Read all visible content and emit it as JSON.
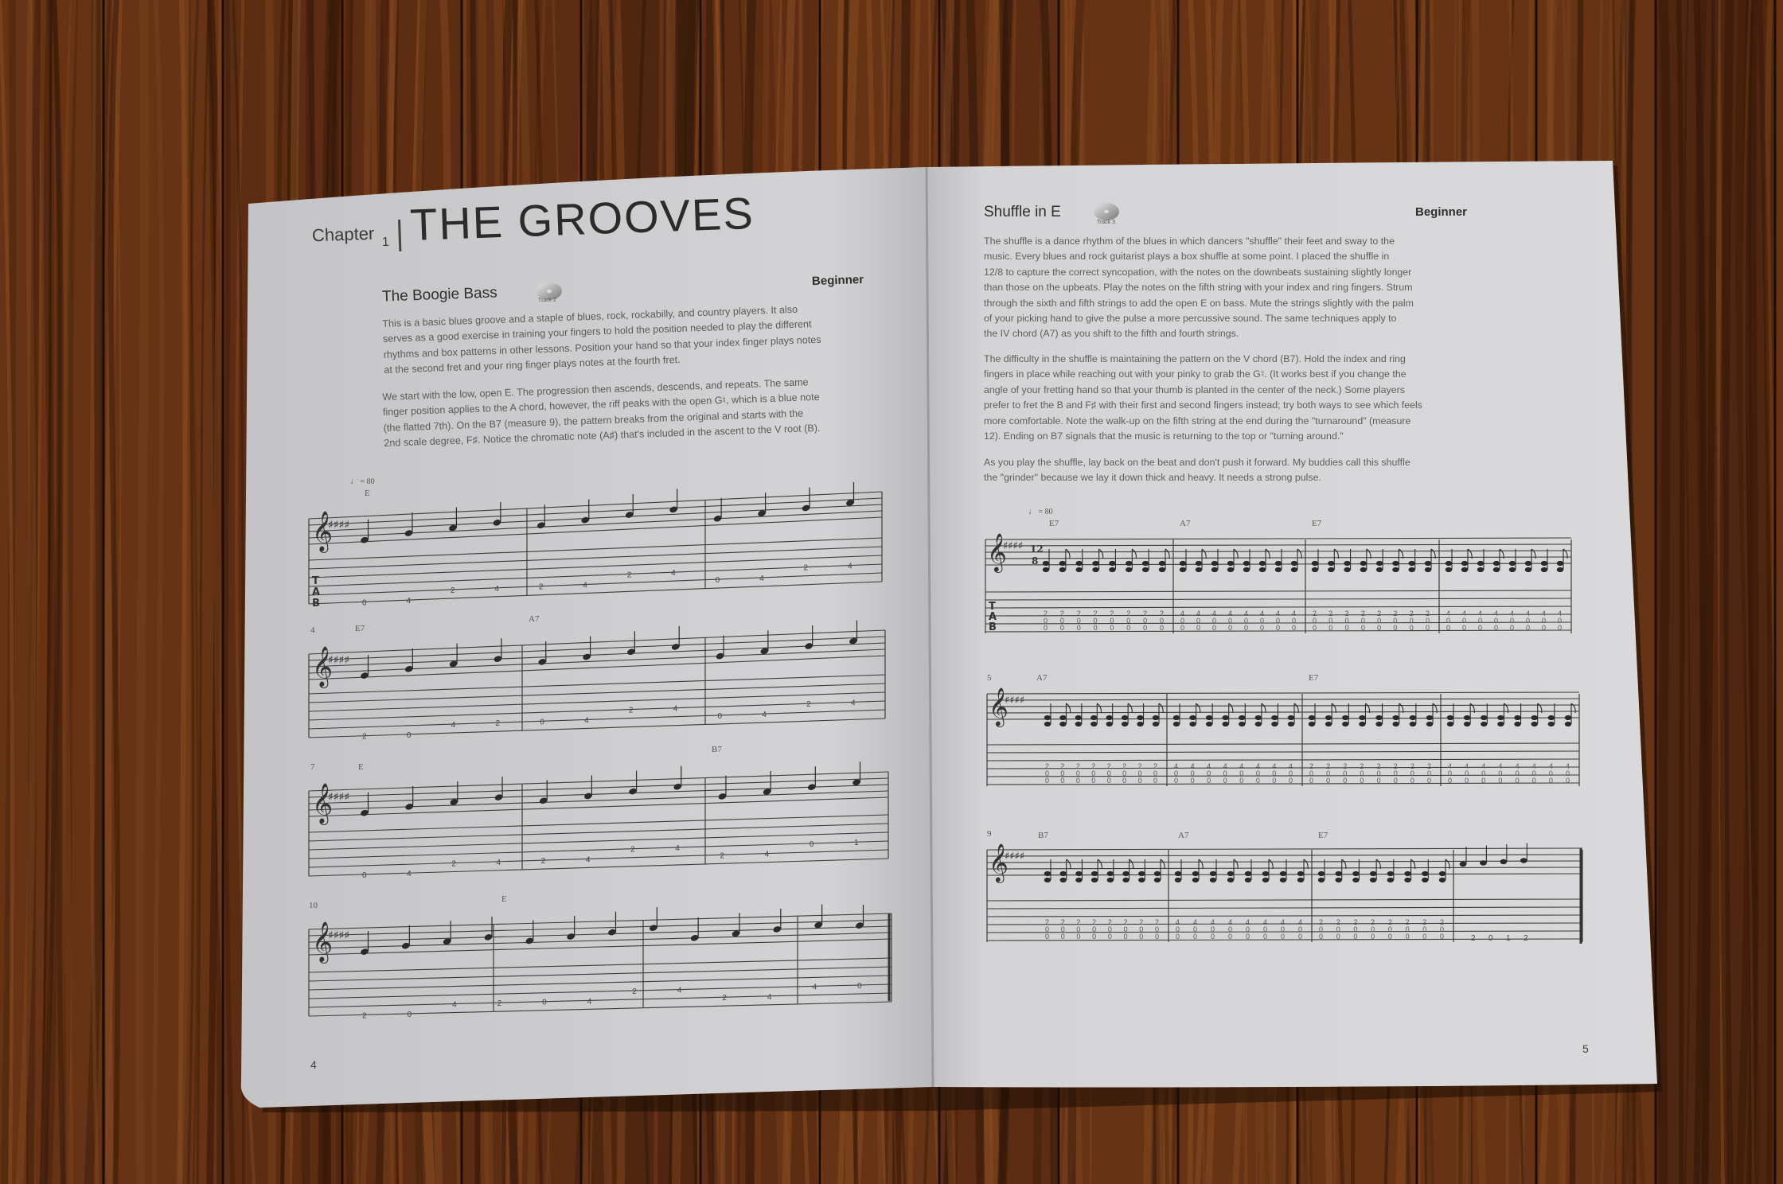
{
  "left_page": {
    "chapter_label": "Chapter",
    "chapter_number": "1",
    "chapter_title": "THE GROOVES",
    "section_title": "The Boogie Bass",
    "track_label": "Track 2",
    "level": "Beginner",
    "paragraphs": [
      [
        "This is a basic blues groove and a staple of blues, rock, rockabilly, and country players. It also",
        "serves as a good exercise in training your fingers to hold the position needed to play the different",
        "rhythms and box patterns in other lessons. Position your hand so that your index finger plays notes",
        "at the second fret and your ring finger plays notes at the fourth fret."
      ],
      [
        "We start with the low, open E. The progression then ascends, descends, and repeats. The same",
        "finger position applies to the A chord, however, the riff peaks with the open G♮, which is a blue note",
        "(the flatted 7th). On the B7 (measure 9), the pattern breaks from the original and starts with the",
        "2nd scale degree, F♯. Notice the chromatic note (A♯) that's included in the ascent to the V root (B)."
      ]
    ],
    "tempo": "♩ = 80",
    "systems": [
      {
        "number": "",
        "chords": [
          "E"
        ],
        "tab": [
          "0",
          "4",
          "2",
          "4",
          "2",
          "4",
          "2",
          "4",
          "0",
          "4",
          "2",
          "4"
        ]
      },
      {
        "number": "4",
        "chords": [
          "E7",
          "A7"
        ],
        "tab": [
          "2",
          "0",
          "4",
          "2",
          "0",
          "4",
          "2",
          "4",
          "0",
          "4",
          "2",
          "4"
        ]
      },
      {
        "number": "7",
        "chords": [
          "E",
          "B7"
        ],
        "tab": [
          "0",
          "4",
          "2",
          "4",
          "2",
          "4",
          "2",
          "4",
          "2",
          "4",
          "0",
          "1"
        ]
      },
      {
        "number": "10",
        "chords": [
          "E"
        ],
        "tab": [
          "2",
          "0",
          "4",
          "2",
          "0",
          "4",
          "2",
          "4",
          "2",
          "4",
          "4",
          "0"
        ]
      }
    ],
    "page_number": "4"
  },
  "right_page": {
    "section_title": "Shuffle in E",
    "track_label": "Track 3",
    "level": "Beginner",
    "paragraphs": [
      [
        "The shuffle is a dance rhythm of the blues in which dancers \"shuffle\" their feet and sway to the",
        "music. Every blues and rock guitarist plays a box shuffle at some point. I placed the shuffle in",
        "12/8 to capture the correct syncopation, with the notes on the downbeats sustaining slightly longer",
        "than those on the upbeats. Play the notes on the fifth string with your index and ring fingers. Strum",
        "through the sixth and fifth strings to add the open E on bass. Mute the strings slightly with the palm",
        "of your picking hand to give the pulse a more percussive sound. The same techniques apply to",
        "the IV chord (A7) as you shift to the fifth and fourth strings."
      ],
      [
        "The difficulty in the shuffle is maintaining the pattern on the V chord (B7). Hold the index and ring",
        "fingers in place while reaching out with your pinky to grab the G♮. (It works best if you change the",
        "angle of your fretting hand so that your thumb is planted in the center of the neck.) Some players",
        "prefer to fret the B and F♯ with their first and second fingers instead; try both ways to see which feels",
        "more comfortable. Note the walk-up on the fifth string at the end during the \"turnaround\" (measure",
        "12). Ending on B7 signals that the music is returning to the top or \"turning around.\""
      ],
      [
        "As you play the shuffle, lay back on the beat and don't push it forward. My buddies call this shuffle",
        "the \"grinder\" because we lay it down thick and heavy. It needs a strong pulse."
      ]
    ],
    "tempo": "♩ = 80",
    "systems": [
      {
        "number": "",
        "chords": [
          "E7",
          "A7",
          "E7"
        ]
      },
      {
        "number": "5",
        "chords": [
          "A7",
          "E7"
        ]
      },
      {
        "number": "9",
        "chords": [
          "B7",
          "A7",
          "E7"
        ]
      }
    ],
    "turnaround_tab": [
      "2",
      "0",
      "1",
      "2"
    ],
    "page_number": "5"
  },
  "colors": {
    "floor_base": "#5a2e14",
    "floor_dark": "#2f1608",
    "floor_light": "#8a4c22",
    "paper_left": "#cfcfd2",
    "paper_right": "#d6d6d8",
    "ink": "#2b2b2b"
  }
}
